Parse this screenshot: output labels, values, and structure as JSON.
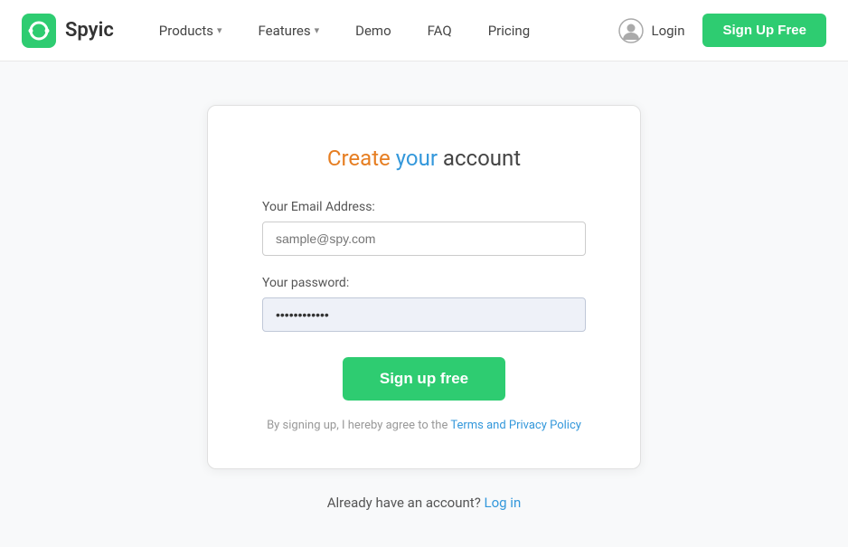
{
  "header": {
    "logo_text": "Spyic",
    "nav_items": [
      {
        "label": "Products",
        "has_dropdown": true
      },
      {
        "label": "Features",
        "has_dropdown": true
      },
      {
        "label": "Demo",
        "has_dropdown": false
      },
      {
        "label": "FAQ",
        "has_dropdown": false
      },
      {
        "label": "Pricing",
        "has_dropdown": false
      }
    ],
    "login_label": "Login",
    "signup_label": "Sign Up Free"
  },
  "card": {
    "title_create": "Create",
    "title_your": "your",
    "title_account": "account",
    "email_label": "Your Email Address:",
    "email_placeholder": "sample@spy.com",
    "password_label": "Your password:",
    "password_value": "············",
    "signup_btn_label": "Sign up free",
    "terms_prefix": "By signing up, I hereby agree to the",
    "terms_link_label": "Terms and Privacy Policy",
    "already_text": "Already have an account?",
    "login_link_label": "Log in"
  }
}
